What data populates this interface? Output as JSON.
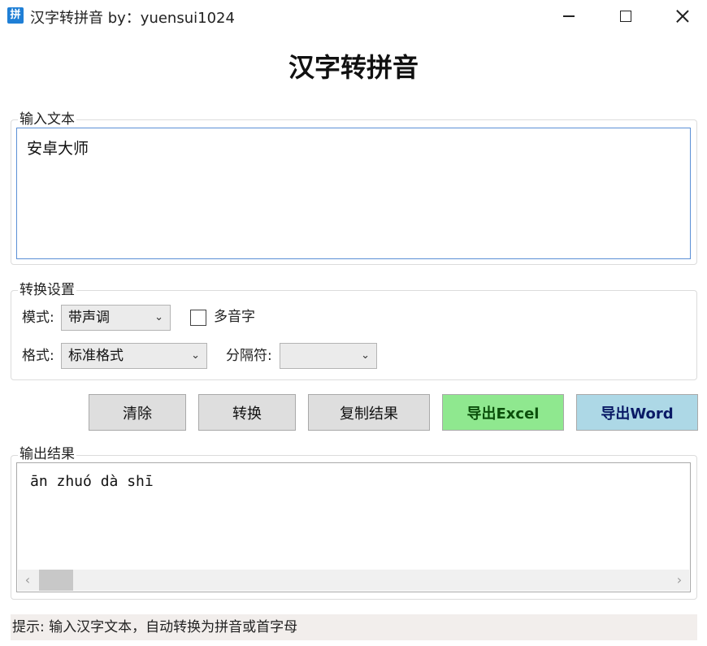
{
  "window": {
    "icon_glyph": "拼",
    "title": "汉字转拼音 by：yuensui1024"
  },
  "header": {
    "title": "汉字转拼音"
  },
  "input": {
    "group_label": "输入文本",
    "value": "安卓大师"
  },
  "settings": {
    "group_label": "转换设置",
    "mode_label": "模式:",
    "mode_value": "带声调",
    "polyphone_label": "多音字",
    "polyphone_checked": false,
    "format_label": "格式:",
    "format_value": "标准格式",
    "separator_label": "分隔符:",
    "separator_value": ""
  },
  "actions": {
    "clear": "清除",
    "convert": "转换",
    "copy": "复制结果",
    "export_excel": "导出Excel",
    "export_word": "导出Word"
  },
  "output": {
    "group_label": "输出结果",
    "value": "ān zhuó dà shī"
  },
  "status": {
    "text": "提示: 输入汉字文本，自动转换为拼音或首字母"
  },
  "colors": {
    "excel_button": "#8fe88f",
    "word_button": "#add8e6",
    "input_focus_border": "#5b8fd6"
  }
}
